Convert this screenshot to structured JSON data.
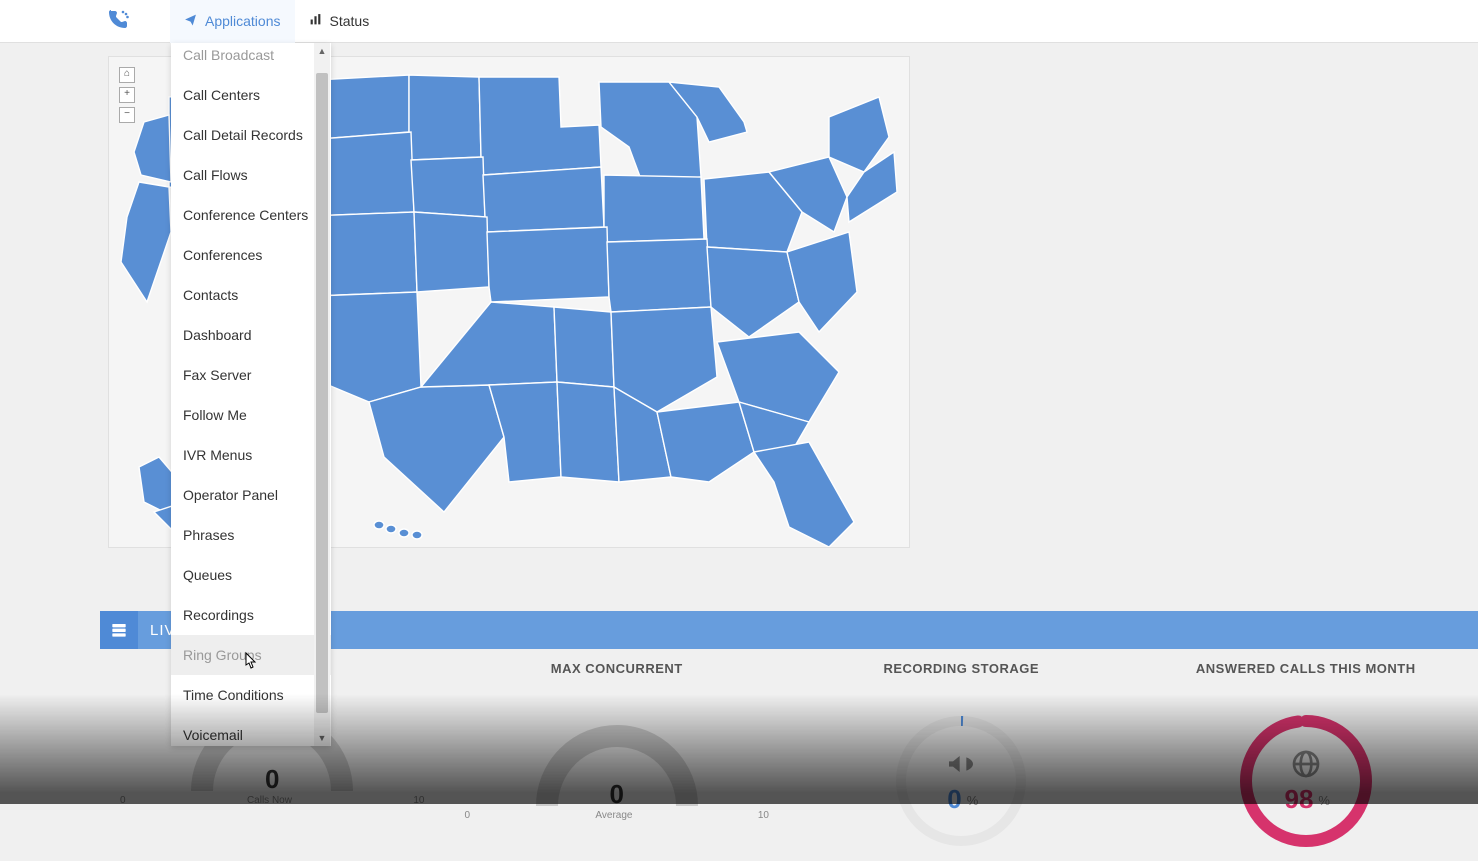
{
  "nav": {
    "applications": "Applications",
    "status": "Status"
  },
  "dropdown": {
    "items": [
      "Call Broadcast",
      "Call Centers",
      "Call Detail Records",
      "Call Flows",
      "Conference Centers",
      "Conferences",
      "Contacts",
      "Dashboard",
      "Fax Server",
      "Follow Me",
      "IVR Menus",
      "Operator Panel",
      "Phrases",
      "Queues",
      "Recordings",
      "Ring Groups",
      "Time Conditions",
      "Voicemail"
    ],
    "hover_index": 15
  },
  "map_controls": {
    "home": "⌂",
    "plus": "+",
    "minus": "−"
  },
  "section_bar": {
    "label": "LIV"
  },
  "stats": {
    "cols": [
      {
        "title": "",
        "type": "gauge",
        "value": "0",
        "left_label": "0",
        "center_label": "Calls Now",
        "right_label": "10"
      },
      {
        "title": "MAX CONCURRENT",
        "type": "gauge",
        "value": "0",
        "left_label": "0",
        "center_label": "Average",
        "right_label": "10"
      },
      {
        "title": "RECORDING STORAGE",
        "type": "ring",
        "icon": "bullhorn",
        "value": "0",
        "pct": "%",
        "color": "blue"
      },
      {
        "title": "ANSWERED CALLS THIS MONTH",
        "type": "ring",
        "icon": "globe",
        "value": "98",
        "pct": "%",
        "color": "pink"
      }
    ]
  },
  "colors": {
    "primary": "#4f8ad6",
    "map_fill": "#598fd4",
    "pink": "#d6336c"
  }
}
